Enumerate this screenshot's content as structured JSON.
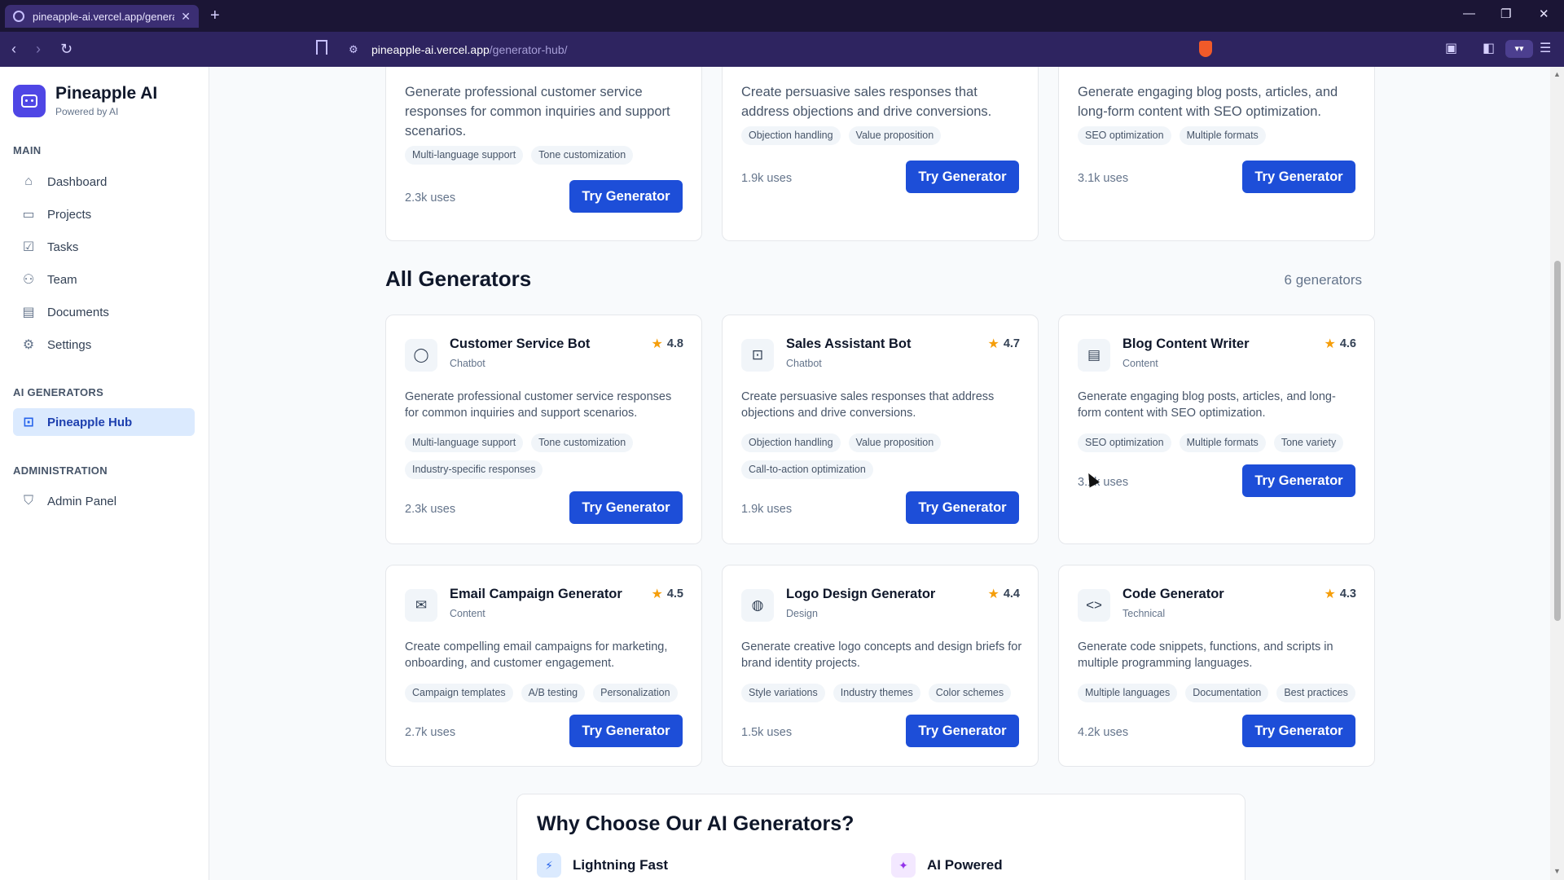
{
  "browser": {
    "tab_title": "pineapple-ai.vercel.app/generato",
    "url_host": "pineapple-ai.vercel.app",
    "url_path": "/generator-hub/"
  },
  "sidebar": {
    "brand_name": "Pineapple AI",
    "brand_sub": "Powered by AI",
    "sections": [
      {
        "label": "MAIN"
      },
      {
        "label": "AI GENERATORS"
      },
      {
        "label": "ADMINISTRATION"
      }
    ],
    "items": [
      {
        "label": "Dashboard",
        "icon": "home-icon"
      },
      {
        "label": "Projects",
        "icon": "folder-icon"
      },
      {
        "label": "Tasks",
        "icon": "check-square-icon"
      },
      {
        "label": "Team",
        "icon": "users-icon"
      },
      {
        "label": "Documents",
        "icon": "file-icon"
      },
      {
        "label": "Settings",
        "icon": "gear-icon"
      },
      {
        "label": "Pineapple Hub",
        "icon": "bot-icon",
        "active": true
      },
      {
        "label": "Admin Panel",
        "icon": "shield-icon"
      }
    ]
  },
  "featured": [
    {
      "desc": "Generate professional customer service responses for common inquiries and support scenarios.",
      "tags": [
        "Multi-language support",
        "Tone customization"
      ],
      "uses": "2.3k uses",
      "button": "Try Generator"
    },
    {
      "desc": "Create persuasive sales responses that address objections and drive conversions.",
      "tags": [
        "Objection handling",
        "Value proposition"
      ],
      "uses": "1.9k uses",
      "button": "Try Generator"
    },
    {
      "desc": "Generate engaging blog posts, articles, and long-form content with SEO optimization.",
      "tags": [
        "SEO optimization",
        "Multiple formats"
      ],
      "uses": "3.1k uses",
      "button": "Try Generator"
    }
  ],
  "all_generators": {
    "title": "All Generators",
    "count": "6 generators",
    "cards": [
      {
        "title": "Customer Service Bot",
        "category": "Chatbot",
        "rating": "4.8",
        "icon": "chat-bubble-icon",
        "desc": "Generate professional customer service responses for common inquiries and support scenarios.",
        "tags": [
          "Multi-language support",
          "Tone customization",
          "Industry-specific responses"
        ],
        "uses": "2.3k uses",
        "button": "Try Generator"
      },
      {
        "title": "Sales Assistant Bot",
        "category": "Chatbot",
        "rating": "4.7",
        "icon": "bot-icon",
        "desc": "Create persuasive sales responses that address objections and drive conversions.",
        "tags": [
          "Objection handling",
          "Value proposition",
          "Call-to-action optimization"
        ],
        "uses": "1.9k uses",
        "button": "Try Generator"
      },
      {
        "title": "Blog Content Writer",
        "category": "Content",
        "rating": "4.6",
        "icon": "document-icon",
        "desc": "Generate engaging blog posts, articles, and long-form content with SEO optimization.",
        "tags": [
          "SEO optimization",
          "Multiple formats",
          "Tone variety"
        ],
        "uses": "3.1k uses",
        "button": "Try Generator"
      },
      {
        "title": "Email Campaign Generator",
        "category": "Content",
        "rating": "4.5",
        "icon": "mail-icon",
        "desc": "Create compelling email campaigns for marketing, onboarding, and customer engagement.",
        "tags": [
          "Campaign templates",
          "A/B testing",
          "Personalization"
        ],
        "uses": "2.7k uses",
        "button": "Try Generator"
      },
      {
        "title": "Logo Design Generator",
        "category": "Design",
        "rating": "4.4",
        "icon": "palette-icon",
        "desc": "Generate creative logo concepts and design briefs for brand identity projects.",
        "tags": [
          "Style variations",
          "Industry themes",
          "Color schemes"
        ],
        "uses": "1.5k uses",
        "button": "Try Generator"
      },
      {
        "title": "Code Generator",
        "category": "Technical",
        "rating": "4.3",
        "icon": "code-icon",
        "desc": "Generate code snippets, functions, and scripts in multiple programming languages.",
        "tags": [
          "Multiple languages",
          "Documentation",
          "Best practices"
        ],
        "uses": "4.2k uses",
        "button": "Try Generator"
      }
    ]
  },
  "why": {
    "title": "Why Choose Our AI Generators?",
    "features": [
      {
        "label": "Lightning Fast",
        "icon": "lightning-icon"
      },
      {
        "label": "AI Powered",
        "icon": "sparkle-icon"
      }
    ]
  },
  "colors": {
    "accent": "#1d4ed8",
    "brand": "#4f46e5",
    "star": "#f59e0b"
  }
}
